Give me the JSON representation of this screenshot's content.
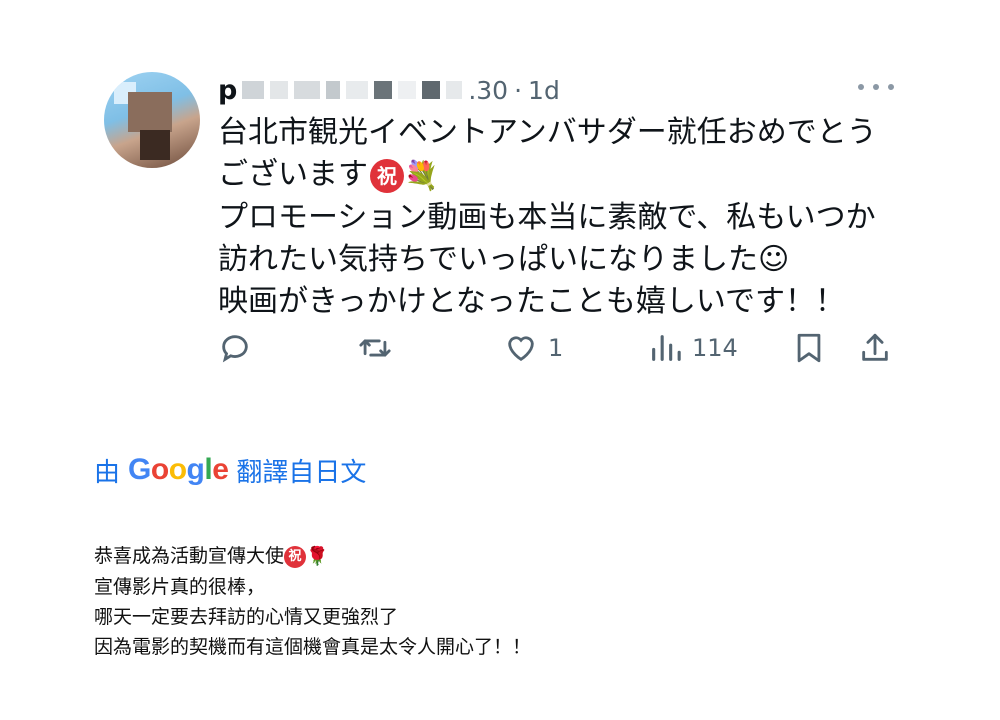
{
  "tweet": {
    "username": "p",
    "handle_tail": ".30",
    "separator": "·",
    "time": "1d",
    "text_lines": [
      "台北市観光イベントアンバサダー就任おめでとう",
      "ございます",
      "プロモーション動画も本当に素敵で、私もいつか",
      "訪れたい気持ちでいっぱいになりました☺",
      "映画がきっかけとなったことも嬉しいです！！"
    ],
    "celebrate_emoji": "祝",
    "bouquet_emoji": "💐",
    "actions": {
      "reply_icon": "reply-icon",
      "retweet_icon": "retweet-icon",
      "like_icon": "heart-icon",
      "like_count": "1",
      "views_icon": "views-icon",
      "views_count": "114",
      "bookmark_icon": "bookmark-icon",
      "share_icon": "share-icon"
    }
  },
  "translation": {
    "prefix": "由",
    "brand": "Google",
    "suffix": "翻譯自日文",
    "lines": [
      "恭喜成為活動宣傳大使",
      "宣傳影片真的很棒，",
      "哪天一定要去拜訪的心情又更強烈了",
      "因為電影的契機而有這個機會真是太令人開心了！！"
    ],
    "celebrate_emoji": "祝",
    "rose_emoji": "🌹"
  }
}
